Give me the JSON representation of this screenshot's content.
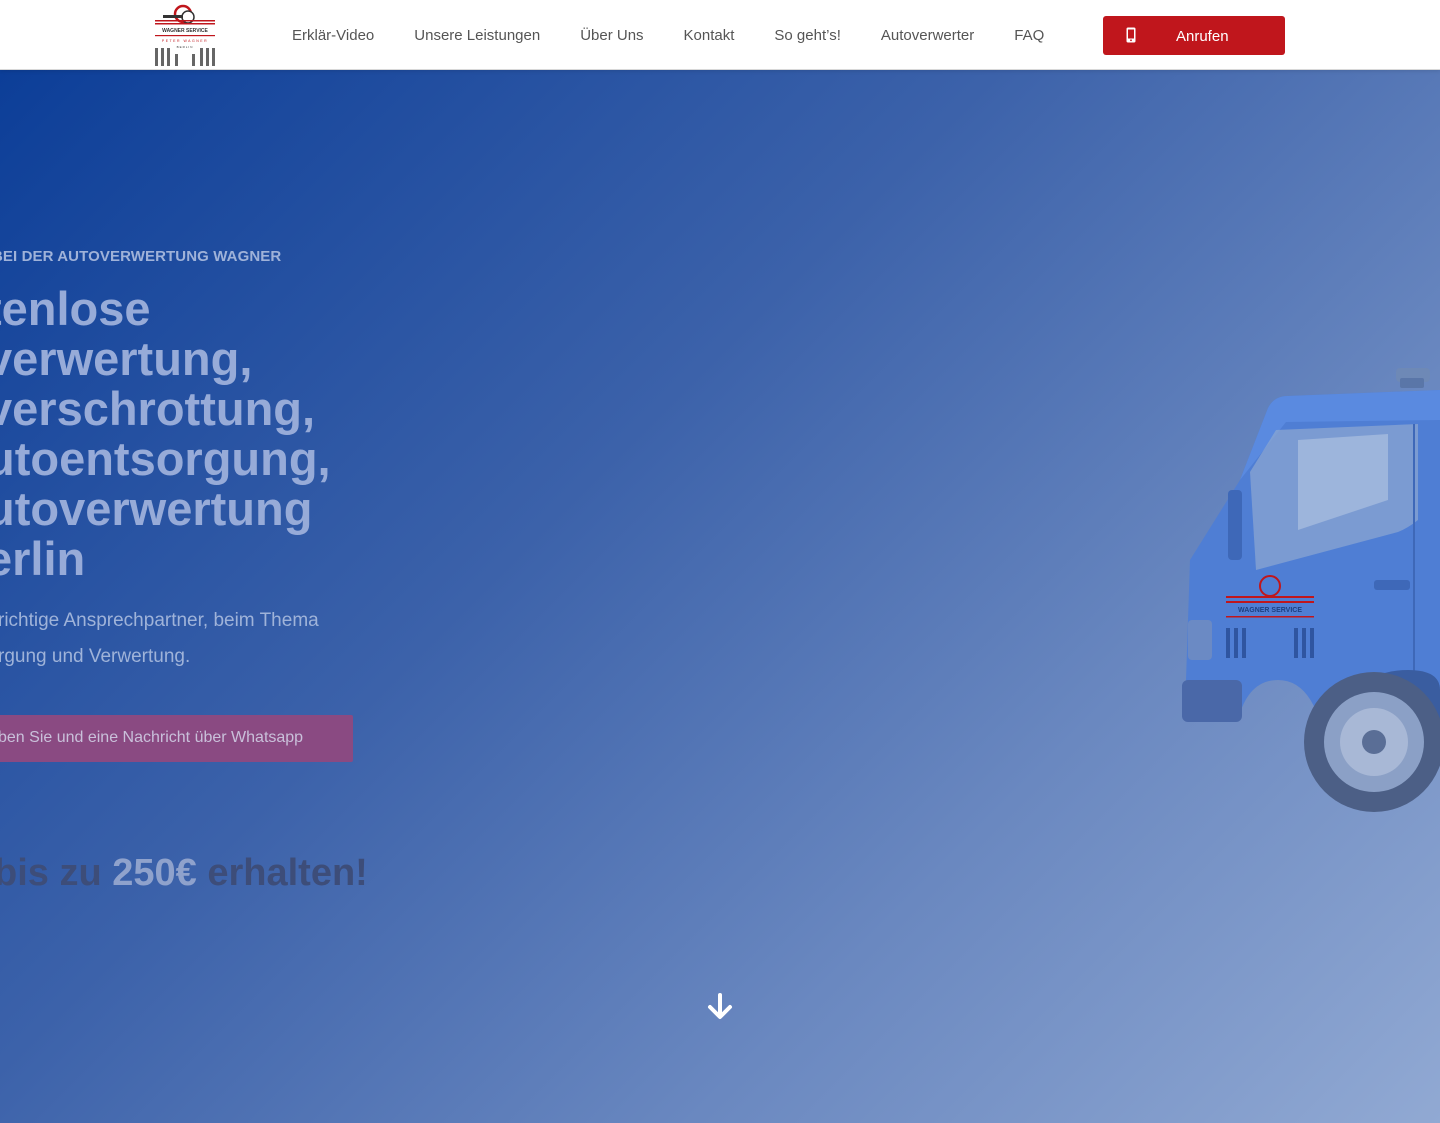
{
  "header": {
    "logo": {
      "brand_text": "WAGNER SERVICE",
      "owner_text": "PETER WAGNER",
      "city_text": "BERLIN",
      "icon": "logo-icon"
    },
    "nav": [
      {
        "label": "Erklär-Video"
      },
      {
        "label": "Unsere Leistungen"
      },
      {
        "label": "Über Uns"
      },
      {
        "label": "Kontakt"
      },
      {
        "label": "So geht’s!"
      },
      {
        "label": "Autoverwerter"
      },
      {
        "label": "FAQ"
      }
    ],
    "call_button": {
      "label": "Anrufen",
      "icon": "phone-icon"
    }
  },
  "hero": {
    "kicker": "BEI DER AUTOVERWERTUNG WAGNER",
    "headline_lines": [
      "tenlose",
      "verwertung,",
      "verschrottung,",
      "utoentsorgung,",
      "utoverwertung",
      "erlin"
    ],
    "subtext_lines": [
      "richtige Ansprechpartner, beim Thema",
      "rgung und Verwertung."
    ],
    "whatsapp_button": "ben Sie und eine Nachricht über Whatsapp",
    "promo": {
      "prefix": "bis zu ",
      "amount": "250€",
      "suffix": " erhalten!"
    },
    "scroll_icon": "arrow-down-icon",
    "truck_icon": "truck-icon"
  },
  "colors": {
    "accent_red": "#c0161c",
    "hero_gradient_start": "#0c3e98",
    "hero_gradient_end": "#91a9d3",
    "whatsapp_button": "#8a4a82"
  }
}
